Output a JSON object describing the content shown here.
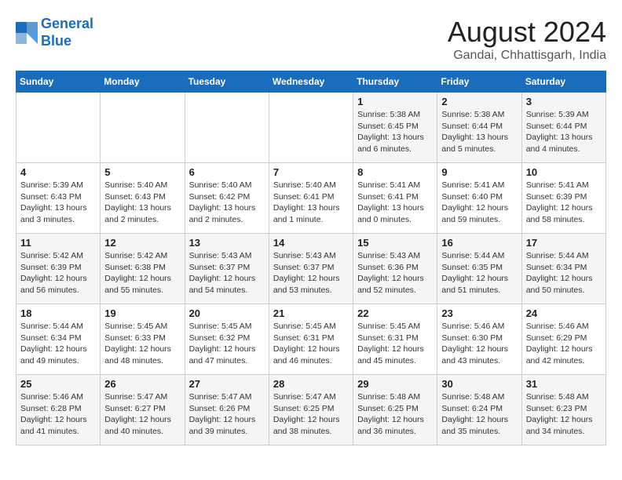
{
  "header": {
    "logo_line1": "General",
    "logo_line2": "Blue",
    "title": "August 2024",
    "subtitle": "Gandai, Chhattisgarh, India"
  },
  "days_of_week": [
    "Sunday",
    "Monday",
    "Tuesday",
    "Wednesday",
    "Thursday",
    "Friday",
    "Saturday"
  ],
  "weeks": [
    [
      {
        "day": "",
        "info": ""
      },
      {
        "day": "",
        "info": ""
      },
      {
        "day": "",
        "info": ""
      },
      {
        "day": "",
        "info": ""
      },
      {
        "day": "1",
        "info": "Sunrise: 5:38 AM\nSunset: 6:45 PM\nDaylight: 13 hours\nand 6 minutes."
      },
      {
        "day": "2",
        "info": "Sunrise: 5:38 AM\nSunset: 6:44 PM\nDaylight: 13 hours\nand 5 minutes."
      },
      {
        "day": "3",
        "info": "Sunrise: 5:39 AM\nSunset: 6:44 PM\nDaylight: 13 hours\nand 4 minutes."
      }
    ],
    [
      {
        "day": "4",
        "info": "Sunrise: 5:39 AM\nSunset: 6:43 PM\nDaylight: 13 hours\nand 3 minutes."
      },
      {
        "day": "5",
        "info": "Sunrise: 5:40 AM\nSunset: 6:43 PM\nDaylight: 13 hours\nand 2 minutes."
      },
      {
        "day": "6",
        "info": "Sunrise: 5:40 AM\nSunset: 6:42 PM\nDaylight: 13 hours\nand 2 minutes."
      },
      {
        "day": "7",
        "info": "Sunrise: 5:40 AM\nSunset: 6:41 PM\nDaylight: 13 hours\nand 1 minute."
      },
      {
        "day": "8",
        "info": "Sunrise: 5:41 AM\nSunset: 6:41 PM\nDaylight: 13 hours\nand 0 minutes."
      },
      {
        "day": "9",
        "info": "Sunrise: 5:41 AM\nSunset: 6:40 PM\nDaylight: 12 hours\nand 59 minutes."
      },
      {
        "day": "10",
        "info": "Sunrise: 5:41 AM\nSunset: 6:39 PM\nDaylight: 12 hours\nand 58 minutes."
      }
    ],
    [
      {
        "day": "11",
        "info": "Sunrise: 5:42 AM\nSunset: 6:39 PM\nDaylight: 12 hours\nand 56 minutes."
      },
      {
        "day": "12",
        "info": "Sunrise: 5:42 AM\nSunset: 6:38 PM\nDaylight: 12 hours\nand 55 minutes."
      },
      {
        "day": "13",
        "info": "Sunrise: 5:43 AM\nSunset: 6:37 PM\nDaylight: 12 hours\nand 54 minutes."
      },
      {
        "day": "14",
        "info": "Sunrise: 5:43 AM\nSunset: 6:37 PM\nDaylight: 12 hours\nand 53 minutes."
      },
      {
        "day": "15",
        "info": "Sunrise: 5:43 AM\nSunset: 6:36 PM\nDaylight: 12 hours\nand 52 minutes."
      },
      {
        "day": "16",
        "info": "Sunrise: 5:44 AM\nSunset: 6:35 PM\nDaylight: 12 hours\nand 51 minutes."
      },
      {
        "day": "17",
        "info": "Sunrise: 5:44 AM\nSunset: 6:34 PM\nDaylight: 12 hours\nand 50 minutes."
      }
    ],
    [
      {
        "day": "18",
        "info": "Sunrise: 5:44 AM\nSunset: 6:34 PM\nDaylight: 12 hours\nand 49 minutes."
      },
      {
        "day": "19",
        "info": "Sunrise: 5:45 AM\nSunset: 6:33 PM\nDaylight: 12 hours\nand 48 minutes."
      },
      {
        "day": "20",
        "info": "Sunrise: 5:45 AM\nSunset: 6:32 PM\nDaylight: 12 hours\nand 47 minutes."
      },
      {
        "day": "21",
        "info": "Sunrise: 5:45 AM\nSunset: 6:31 PM\nDaylight: 12 hours\nand 46 minutes."
      },
      {
        "day": "22",
        "info": "Sunrise: 5:45 AM\nSunset: 6:31 PM\nDaylight: 12 hours\nand 45 minutes."
      },
      {
        "day": "23",
        "info": "Sunrise: 5:46 AM\nSunset: 6:30 PM\nDaylight: 12 hours\nand 43 minutes."
      },
      {
        "day": "24",
        "info": "Sunrise: 5:46 AM\nSunset: 6:29 PM\nDaylight: 12 hours\nand 42 minutes."
      }
    ],
    [
      {
        "day": "25",
        "info": "Sunrise: 5:46 AM\nSunset: 6:28 PM\nDaylight: 12 hours\nand 41 minutes."
      },
      {
        "day": "26",
        "info": "Sunrise: 5:47 AM\nSunset: 6:27 PM\nDaylight: 12 hours\nand 40 minutes."
      },
      {
        "day": "27",
        "info": "Sunrise: 5:47 AM\nSunset: 6:26 PM\nDaylight: 12 hours\nand 39 minutes."
      },
      {
        "day": "28",
        "info": "Sunrise: 5:47 AM\nSunset: 6:25 PM\nDaylight: 12 hours\nand 38 minutes."
      },
      {
        "day": "29",
        "info": "Sunrise: 5:48 AM\nSunset: 6:25 PM\nDaylight: 12 hours\nand 36 minutes."
      },
      {
        "day": "30",
        "info": "Sunrise: 5:48 AM\nSunset: 6:24 PM\nDaylight: 12 hours\nand 35 minutes."
      },
      {
        "day": "31",
        "info": "Sunrise: 5:48 AM\nSunset: 6:23 PM\nDaylight: 12 hours\nand 34 minutes."
      }
    ]
  ]
}
